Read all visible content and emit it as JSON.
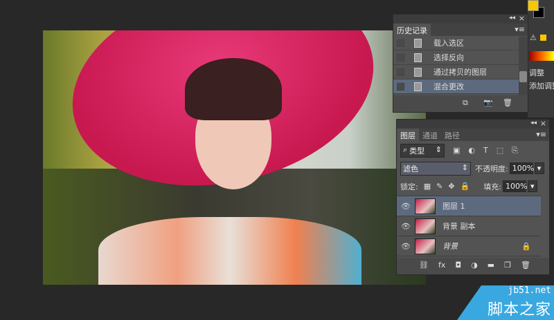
{
  "canvas": {
    "accent_hat": "#d4205a"
  },
  "history": {
    "title": "历史记录",
    "items": [
      {
        "label": "载入选区",
        "selected": false
      },
      {
        "label": "选择反向",
        "selected": false
      },
      {
        "label": "通过拷贝的图层",
        "selected": false
      },
      {
        "label": "混合更改",
        "selected": true
      }
    ]
  },
  "layers": {
    "tabs": [
      "图层",
      "通道",
      "路径"
    ],
    "filter": "类型",
    "blend_mode": "滤色",
    "opacity_label": "不透明度:",
    "opacity": "100%",
    "lock_label": "锁定:",
    "fill_label": "填充:",
    "fill": "100%",
    "items": [
      {
        "name": "图层 1",
        "selected": true,
        "locked": false
      },
      {
        "name": "背景 副本",
        "selected": false,
        "locked": false
      },
      {
        "name": "背景",
        "selected": false,
        "locked": true
      }
    ]
  },
  "right": {
    "adjust_tab": "调整",
    "adjust_add": "添加调整",
    "fg_color": "#f5c800",
    "bg_color": "#000000"
  },
  "watermark": {
    "line1": "jb51.net",
    "line2": "脚本之家"
  }
}
